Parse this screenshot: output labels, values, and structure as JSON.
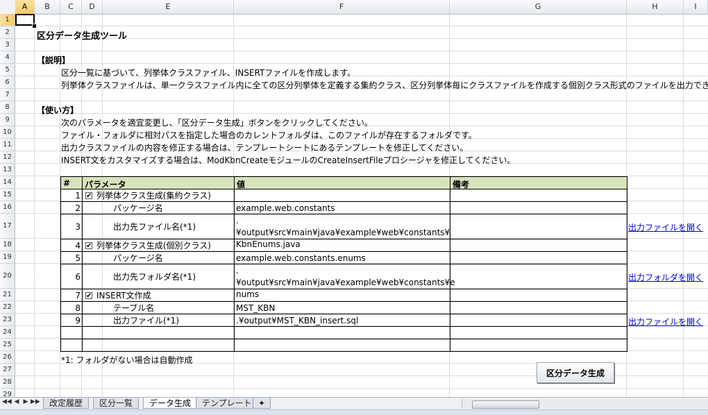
{
  "columns": [
    "A",
    "B",
    "C",
    "D",
    "E",
    "F",
    "G",
    "H",
    "I"
  ],
  "rows": [
    "1",
    "2",
    "3",
    "4",
    "5",
    "6",
    "7",
    "8",
    "9",
    "10",
    "11",
    "12",
    "13",
    "14",
    "15",
    "16",
    "17",
    "18",
    "19",
    "20",
    "21",
    "22",
    "23",
    "24",
    "25",
    "26",
    "27",
    "28",
    "29"
  ],
  "title": "区分データ生成ツール",
  "section_desc": "【説明】",
  "desc_lines": [
    "区分一覧に基づいて、列挙体クラスファイル、INSERTファイルを作成します。",
    "列挙体クラスファイルは、単一クラスファイル内に全ての区分列挙体を定義する集約クラス、区分列挙体毎にクラスファイルを作成する個別クラス形式のファイルを出力できます。"
  ],
  "section_usage": "【使い方】",
  "usage_lines": [
    "次のパラメータを適宜変更し、「区分データ生成」ボタンをクリックしてください。",
    "ファイル・フォルダに相対パスを指定した場合のカレントフォルダは、このファイルが存在するフォルダです。",
    "出力クラスファイルの内容を修正する場合は、テンプレートシートにあるテンプレートを修正してください。",
    "INSERT文をカスタマイズする場合は、ModKbnCreateモジュールのCreateInsertFileプロシージャを修正してください。"
  ],
  "table": {
    "headers": {
      "num": "#",
      "param": "パラメータ",
      "value": "値",
      "note": "備考"
    },
    "rows": [
      {
        "num": "1",
        "checkbox": true,
        "param": "列挙体クラス生成(集約クラス)",
        "indent": false,
        "value1": "",
        "value2": ""
      },
      {
        "num": "2",
        "checkbox": false,
        "param": "パッケージ名",
        "indent": true,
        "value1": "example.web.constants",
        "value2": ""
      },
      {
        "num": "3",
        "checkbox": false,
        "param": "出力先ファイル名(*1)",
        "indent": true,
        "value1": ".¥output¥src¥main¥java¥example¥web¥constants¥",
        "value2": "KbnEnums.java"
      },
      {
        "num": "4",
        "checkbox": true,
        "param": "列挙体クラス生成(個別クラス)",
        "indent": false,
        "value1": "",
        "value2": ""
      },
      {
        "num": "5",
        "checkbox": false,
        "param": "パッケージ名",
        "indent": true,
        "value1": "example.web.constants.enums",
        "value2": ""
      },
      {
        "num": "6",
        "checkbox": false,
        "param": "出力先フォルダ名(*1)",
        "indent": true,
        "value1": ".¥output¥src¥main¥java¥example¥web¥constants¥e",
        "value2": "nums"
      },
      {
        "num": "7",
        "checkbox": true,
        "param": "INSERT文作成",
        "indent": false,
        "value1": "",
        "value2": ""
      },
      {
        "num": "8",
        "checkbox": false,
        "param": "テーブル名",
        "indent": true,
        "value1": "MST_KBN",
        "value2": ""
      },
      {
        "num": "9",
        "checkbox": false,
        "param": "出力ファイル(*1)",
        "indent": true,
        "value1": ".¥output¥MST_KBN_insert.sql",
        "value2": ""
      }
    ]
  },
  "links": {
    "open_file_1": "出力ファイルを開く",
    "open_folder": "出力フォルダを開く",
    "open_file_2": "出力ファイルを開く"
  },
  "footnote": "*1: フォルダがない場合は自動作成",
  "generate_button": "区分データ生成",
  "sheet_tabs": [
    "改定履歴",
    "区分一覧",
    "データ生成",
    "テンプレート"
  ],
  "active_tab": "データ生成",
  "nav_icons": [
    "first-sheet-icon",
    "prev-sheet-icon",
    "next-sheet-icon",
    "last-sheet-icon"
  ]
}
